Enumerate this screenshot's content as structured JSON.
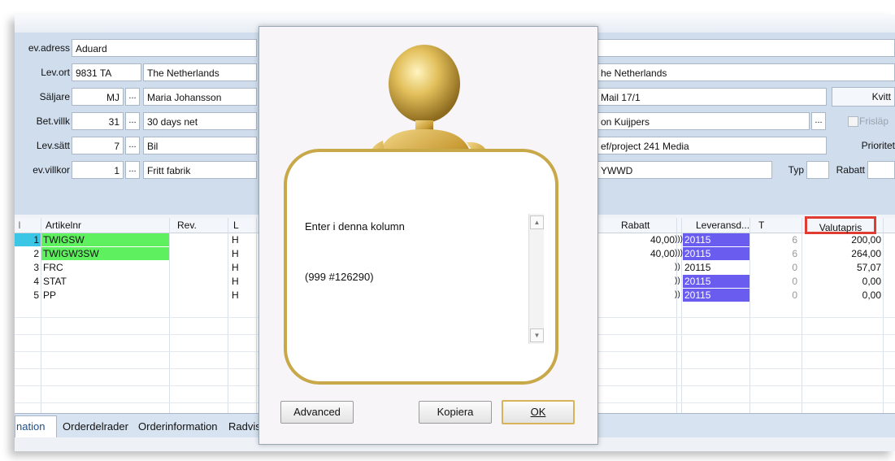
{
  "form": {
    "lev_adress_label": "ev.adress",
    "lev_adress_value": "Aduard",
    "lev_ort_label": "Lev.ort",
    "lev_ort_value": "9831 TA",
    "lev_country": "The Netherlands",
    "saljare_label": "Säljare",
    "saljare_code": "MJ",
    "saljare_name": "Maria Johansson",
    "betvillk_label": "Bet.villk",
    "betvillk_code": "31",
    "betvillk_name": "30 days net",
    "levsatt_label": "Lev.sätt",
    "levsatt_code": "7",
    "levsatt_name": "Bil",
    "levvillkor_label": "ev.villkor",
    "levvillkor_code": "1",
    "levvillkor_name": "Fritt fabrik",
    "dots": "...",
    "right_country": "he Netherlands",
    "right_mail": "Mail 17/1",
    "right_contact": "on Kuijpers",
    "right_ref": "ef/project 241 Media",
    "right_code": "YWWD",
    "typ_label": "Typ",
    "rabatt_label": "Rabatt",
    "kvitt_label": "Kvitt",
    "frislapp_label": "Frisläp",
    "prioritet_label": "Prioritet"
  },
  "grid": {
    "headers": {
      "artikelnr": "Artikelnr",
      "rev": "Rev.",
      "l": "L",
      "rabatt": "Rabatt",
      "leveransd": "Leveransd...",
      "t": "T",
      "valutapris": "Valutapris"
    },
    "rows": [
      {
        "n": "1",
        "art": "TWIGSW",
        "l": "H",
        "rab": "40,00",
        "mark": ")))",
        "lev": "20115",
        "t": "6",
        "pris": "200,00"
      },
      {
        "n": "2",
        "art": "TWIGW3SW",
        "l": "H",
        "rab": "40,00",
        "mark": ")))",
        "lev": "20115",
        "t": "6",
        "pris": "264,00"
      },
      {
        "n": "3",
        "art": "FRC",
        "l": "H",
        "rab": "",
        "mark": "))",
        "lev": "20115",
        "t": "0",
        "pris": "57,07"
      },
      {
        "n": "4",
        "art": "STAT",
        "l": "H",
        "rab": "",
        "mark": "))",
        "lev": "20115",
        "t": "0",
        "pris": "0,00"
      },
      {
        "n": "5",
        "art": "PP",
        "l": "H",
        "rab": "",
        "mark": "))",
        "lev": "20115",
        "t": "0",
        "pris": "0,00"
      }
    ]
  },
  "tabs": [
    "nation",
    "Orderdelrader",
    "Orderinformation",
    "Radvis"
  ],
  "dialog": {
    "message_line1": "Enter i denna kolumn",
    "message_line2": "(999 #126290)",
    "advanced_label": "Advanced",
    "kopiera_label": "Kopiera",
    "ok_label": "OK"
  },
  "colors": {
    "green_highlight": "#5ef05e",
    "blue_highlight": "#6b5cf0",
    "red_outline": "#e03c31",
    "gold": "#c9a84a"
  }
}
